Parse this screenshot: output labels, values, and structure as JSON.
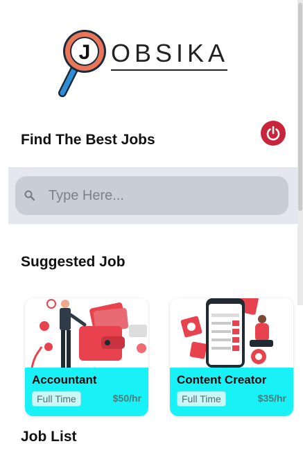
{
  "logo": {
    "letter": "J",
    "text": "OBSIKA"
  },
  "header": {
    "title": "Find The Best Jobs"
  },
  "search": {
    "placeholder": "Type Here..."
  },
  "sections": {
    "suggested": "Suggested Job",
    "job_list": "Job List"
  },
  "suggested_jobs": [
    {
      "title": "Accountant",
      "type": "Full Time",
      "rate": "$50/hr"
    },
    {
      "title": "Content Creator",
      "type": "Full Time",
      "rate": "$35/hr"
    }
  ],
  "colors": {
    "accent": "#18f2f6",
    "power": "#c8253b",
    "search_bg": "#c9ced6",
    "logo_ring": "#e9765a",
    "logo_handle": "#2f8fd6"
  }
}
